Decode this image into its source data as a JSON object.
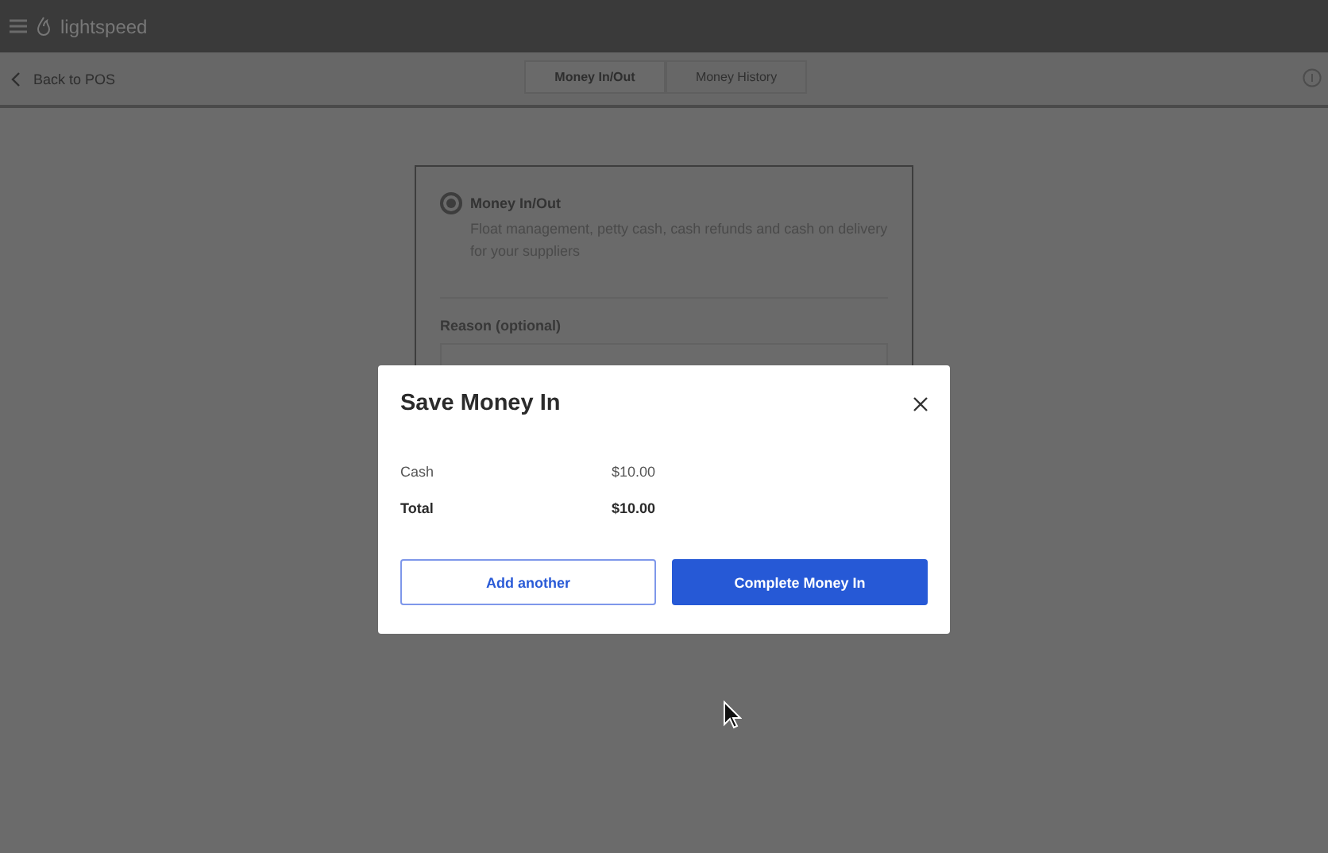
{
  "header": {
    "brand": "lightspeed"
  },
  "nav": {
    "back": "Back to POS",
    "tabs": [
      {
        "label": "Money In/Out",
        "selected": true
      },
      {
        "label": "Money History",
        "selected": false
      }
    ]
  },
  "form": {
    "options": [
      {
        "label": "Money In/Out",
        "description": "Float management, petty cash, cash refunds and cash on delivery for your suppliers",
        "selected": true
      }
    ],
    "reason_label": "Reason (optional)"
  },
  "dialog": {
    "title": "Save Money In",
    "lines": [
      {
        "label": "Cash",
        "amount": "$10.00",
        "kind": "item"
      },
      {
        "label": "Total",
        "amount": "$10.00",
        "kind": "total"
      }
    ],
    "buttons": [
      {
        "label": "Add another",
        "kind": "secondary"
      },
      {
        "label": "Complete Money In",
        "kind": "primary"
      }
    ]
  }
}
